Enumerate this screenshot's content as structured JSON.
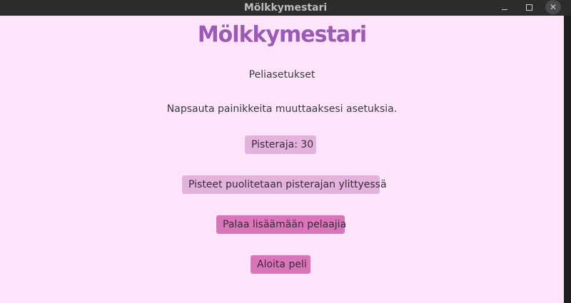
{
  "window": {
    "title": "Mölkkymestari",
    "controls": {
      "minimize": "minimize-icon",
      "maximize": "maximize-icon",
      "close": "close-icon"
    }
  },
  "app": {
    "title": "Mölkkymestari",
    "subtitle": "Peliasetukset",
    "instructions": "Napsauta painikkeita muuttaaksesi asetuksia."
  },
  "buttons": {
    "score_limit": "Pisteraja: 30",
    "halve_points": "Pisteet puolitetaan pisterajan ylittyessä",
    "back_to_players": "Palaa lisäämään pelaajia",
    "start_game": "Aloita peli"
  },
  "colors": {
    "background": "#fde4fb",
    "title": "#9b5ab6",
    "button_light": "#e3b2dd",
    "button_dark": "#d975b8"
  }
}
